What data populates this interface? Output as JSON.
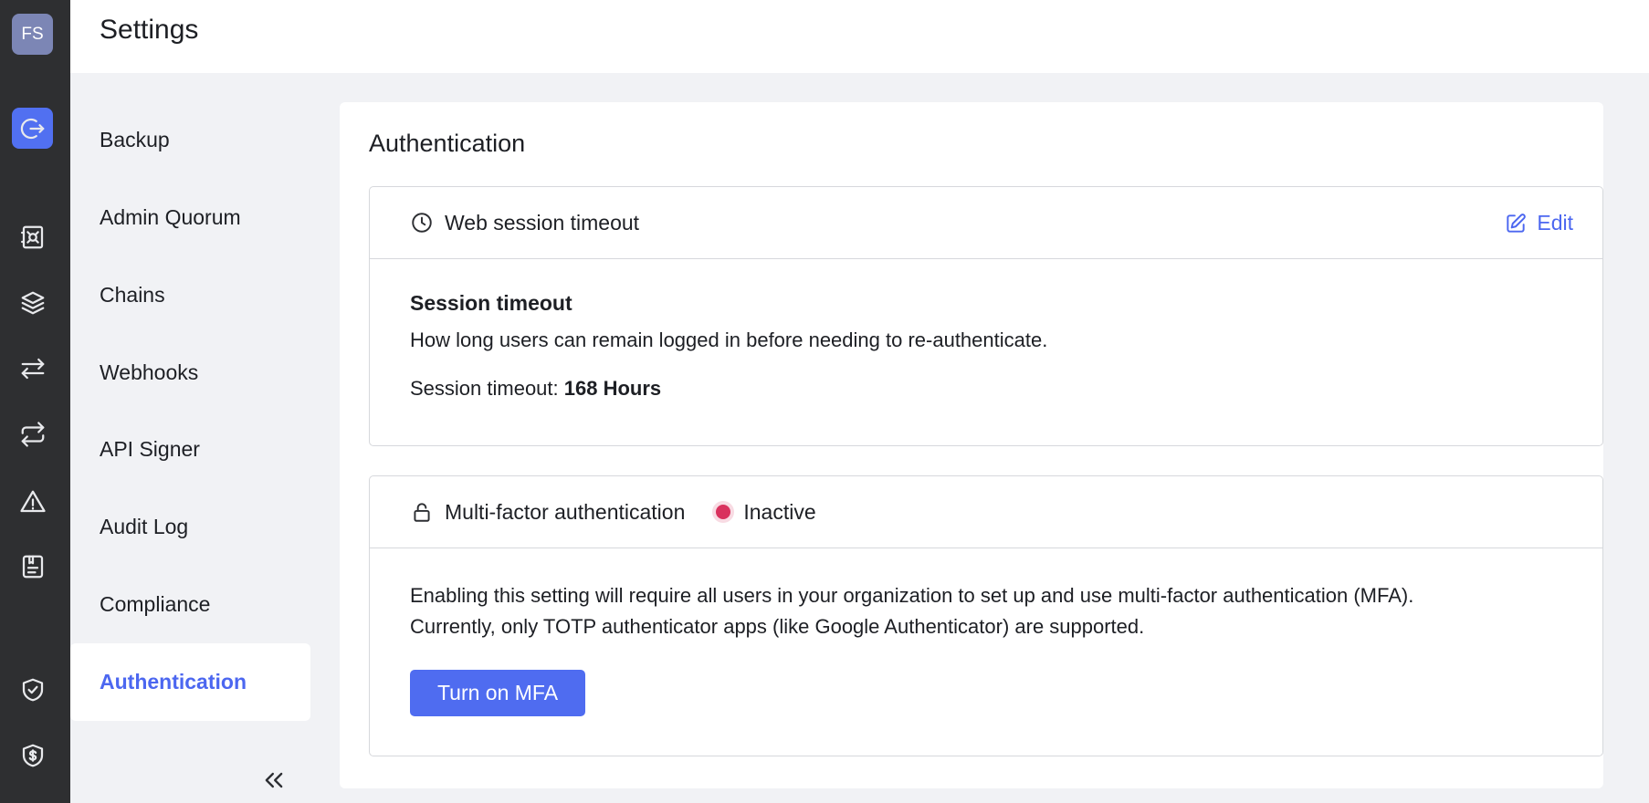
{
  "rail": {
    "avatar_initials": "FS",
    "icons": [
      "logout-icon",
      "vault-icon",
      "layers-icon",
      "transfer-icon",
      "repeat-icon",
      "warning-icon",
      "receipt-icon",
      "shield-check-icon",
      "shield-dollar-icon"
    ]
  },
  "header": {
    "title": "Settings"
  },
  "submenu": {
    "items": [
      {
        "label": "Backup"
      },
      {
        "label": "Admin Quorum"
      },
      {
        "label": "Chains"
      },
      {
        "label": "Webhooks"
      },
      {
        "label": "API Signer"
      },
      {
        "label": "Audit Log"
      },
      {
        "label": "Compliance"
      },
      {
        "label": "Authentication"
      }
    ],
    "active_label": "Authentication"
  },
  "main": {
    "section_title": "Authentication",
    "web_session": {
      "title": "Web session timeout",
      "edit_label": "Edit",
      "heading": "Session timeout",
      "description": "How long users can remain logged in before needing to re-authenticate.",
      "timeout_label": "Session timeout:",
      "timeout_value": "168 Hours"
    },
    "mfa": {
      "title": "Multi-factor authentication",
      "status": "Inactive",
      "status_color": "#d9325e",
      "description_line1": "Enabling this setting will require all users in your organization to set up and use multi-factor authentication (MFA).",
      "description_line2": "Currently, only TOTP authenticator apps (like Google Authenticator) are supported.",
      "button_label": "Turn on MFA"
    }
  },
  "colors": {
    "accent": "#4f6cf0",
    "rail_bg": "#2e2f31",
    "page_bg": "#f1f2f5"
  }
}
